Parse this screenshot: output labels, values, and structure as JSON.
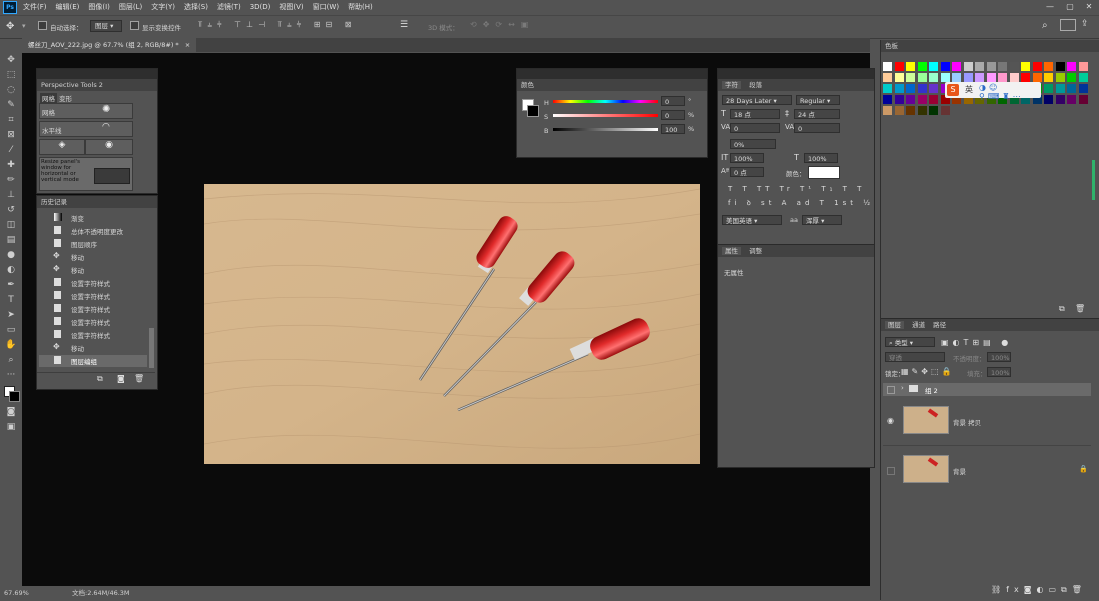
{
  "menubar": {
    "logo": "Ps",
    "items": [
      "文件(F)",
      "编辑(E)",
      "图像(I)",
      "图层(L)",
      "文字(Y)",
      "选择(S)",
      "滤镜(T)",
      "3D(D)",
      "视图(V)",
      "窗口(W)",
      "帮助(H)"
    ]
  },
  "options": {
    "auto_select_label": "自动选择：",
    "auto_select_value": "图层",
    "show_transform_label": "显示变换控件",
    "mode_3d_label": "3D 模式："
  },
  "document": {
    "tab_title": "螺丝刀_AOV_222.jpg @ 67.7% (组 2, RGB/8#) *"
  },
  "status": {
    "zoom": "67.69%",
    "doc_info": "文档:2.64M/46.3M"
  },
  "perspective": {
    "title": "Perspective Tools 2",
    "tab1": "网格",
    "tab2": "变形",
    "grid_label": "网格",
    "horizon_label": "水平线",
    "help_text": "Resize panel's window for horizontal or vertical mode"
  },
  "history": {
    "title": "历史记录",
    "items": [
      "渐变",
      "总体不透明度更改",
      "图层顺序",
      "移动",
      "移动",
      "设置字符样式",
      "设置字符样式",
      "设置字符样式",
      "设置字符样式",
      "设置字符样式",
      "移动",
      "图层编组"
    ]
  },
  "color": {
    "title": "颜色",
    "labels": [
      "H",
      "S",
      "B"
    ],
    "values": [
      "0",
      "0",
      "100"
    ],
    "units": [
      "°",
      "%",
      "%"
    ]
  },
  "character": {
    "tab1": "字符",
    "tab2": "段落",
    "font": "28 Days Later",
    "style": "Regular",
    "size": "18 点",
    "leading": "24 点",
    "kerning": "0",
    "tracking": "0",
    "scale_pct": "0%",
    "vscale": "100%",
    "hscale": "100%",
    "baseline": "0 点",
    "color_label": "颜色：",
    "lang": "美国英语",
    "aa_prefix": "aa",
    "aa": "浑厚"
  },
  "properties": {
    "tab1": "属性",
    "tab2": "调整",
    "empty": "无属性"
  },
  "swatches": {
    "title": "色板",
    "ime_lang": "英",
    "colors": [
      "#ffffff",
      "#ff0000",
      "#ffff00",
      "#00ff00",
      "#00ffff",
      "#0000ff",
      "#ff00ff",
      "#cccccc",
      "#aaaaaa",
      "#999999",
      "#777777",
      "#555555",
      "#ffff00",
      "#ff0000",
      "#ff6600",
      "#000000",
      "#ff00ff",
      "#ff9999",
      "#ffcc99",
      "#ffff99",
      "#ccff99",
      "#99ff99",
      "#99ffcc",
      "#99ffff",
      "#99ccff",
      "#9999ff",
      "#cc99ff",
      "#ff99ff",
      "#ff99cc",
      "#ffcccc",
      "#ff0000",
      "#ff6600",
      "#ffcc00",
      "#99cc00",
      "#00cc00",
      "#00cc99",
      "#00cccc",
      "#0099cc",
      "#0066cc",
      "#3333cc",
      "#6633cc",
      "#9900cc",
      "#cc0099",
      "#cc0066",
      "#cc0000",
      "#cc3300",
      "#cc6600",
      "#999900",
      "#669900",
      "#009900",
      "#009966",
      "#009999",
      "#006699",
      "#003399",
      "#000099",
      "#330099",
      "#660099",
      "#990066",
      "#990033",
      "#990000",
      "#993300",
      "#996600",
      "#666600",
      "#336600",
      "#006600",
      "#006633",
      "#006666",
      "#003366",
      "#000066",
      "#330066",
      "#660066",
      "#660033",
      "#cc9966",
      "#996633",
      "#663300",
      "#333300",
      "#003300",
      "#663333"
    ]
  },
  "layers": {
    "tab1": "图层",
    "tab2": "通道",
    "tab3": "路径",
    "kind": "类型",
    "blend": "穿透",
    "opacity_label": "不透明度：",
    "opacity": "100%",
    "lock_label": "锁定：",
    "fill_label": "填充：",
    "fill": "100%",
    "items": [
      {
        "name": "组 2",
        "type": "group"
      },
      {
        "name": "背景 拷贝",
        "type": "image"
      },
      {
        "name": "背景",
        "type": "image"
      }
    ]
  }
}
